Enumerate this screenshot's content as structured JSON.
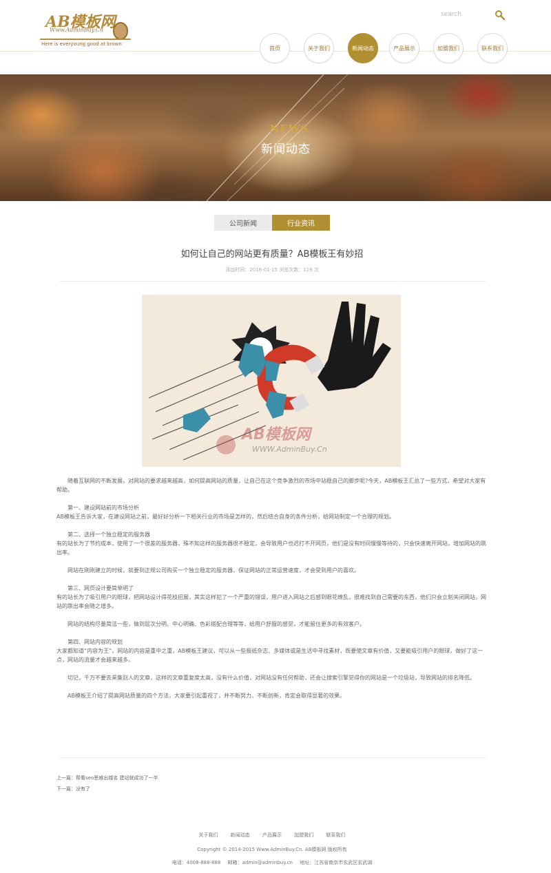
{
  "logo": {
    "main": "AB模板网",
    "sub": "Www.AdminBuy.Cn",
    "tagline": "Here is everyoung good at brown"
  },
  "search": {
    "placeholder": "search"
  },
  "nav": {
    "items": [
      "首页",
      "关于我们",
      "新闻动态",
      "产品展示",
      "加盟我们",
      "联系我们"
    ],
    "active": "新闻动态"
  },
  "banner": {
    "en": "NEWS",
    "cn": "新闻动态"
  },
  "tabs": {
    "items": [
      "公司新闻",
      "行业资讯"
    ],
    "active": "行业资讯"
  },
  "article": {
    "title": "如何让自己的网站更有质量？AB模板王有妙招",
    "meta": "添加时间：2016-01-15 浏览次数：119 次",
    "watermark": "AB模板网",
    "watermark_sub": "WWW.AdminBuy.Cn",
    "paragraphs": [
      "随着互联网的不断发展，对网站的要求越来越高，如何提高网站的质量，让自己在这个竞争激烈的市场中站稳自己的脚步呢?今天，AB模板王汇总了一些方式，希望对大家有帮助。",
      "第一、建设网站前的市场分析",
      "AB模板王告诉大家，在建设网站之前，最好好分析一下相关行业的市场是怎样的，然后结合自身的条件分析，给网站制定一个合理的规划。",
      "第二、选择一个独立稳定的服务器",
      "有的站长为了节约成本，使用了一个很差的服务器，殊不知这样的服务器很不稳定，会导致用户也迟打不开网页，他们是没有时间慢慢等待的，只会快速离开网站，增加网站的跳出率。",
      "网站在刚刚建立的时候，就要到正规公司购买一个独立稳定的服务器，保证网站的正常运营速度，才会受到用户的喜欢。",
      "第三、网页设计要简单明了",
      "有的站长为了吸引用户的眼球，把网站设计得花枝招展，其实这样犯了一个严重的错误，用户进入网站之后感到眼花缭乱，很难找到自己需要的东西，他们只会立刻关闭网站，网站的跳出率会随之增多。",
      "网站的结构尽量简洁一些，做到层次分明、中心明确、色彩搭配合理等等，给用户舒服的感觉，才能留住更多的有效客户。",
      "第四、网站内容的规划",
      "大家都知道“内容为王”，网站的内容是重中之重，AB模板王建议，可以从一些报纸杂志、多媒体或是生活中寻找素材，既要使文章有价值，又要能吸引用户的眼球，做好了这一点，网站的流量才会越来越多。",
      "切记，千万不要去采集别人的文章，这样的文章重复度太高，没有什么价值，对网站没有任何帮助，还会让搜索引擎觉得你的网站是一个垃圾站，导致网站的排名降低。",
      "AB模板王介绍了提高网站质量的四个方法，大家要引起重视了，并不断努力，不断创新，肯定会取得显著的效果。"
    ],
    "prev": "上一篇：帮看seo思维出城名 建站就成功了一半",
    "next": "下一篇：没有了"
  },
  "footer": {
    "links": [
      "关于我们",
      "新闻动态",
      "产品展示",
      "加盟我们",
      "联系我们"
    ],
    "copyright": "Copyright © 2014-2015 Www.AdminBuy.Cn. AB模板网 版权所有",
    "phone": "电话：4008-888-888",
    "email": "邮箱：admin@adminbuy.cn",
    "address": "地址：江苏省南京市玄武区玄武湖"
  },
  "colors": {
    "accent": "#b09030",
    "logo": "#b78a3a",
    "text": "#666666"
  }
}
